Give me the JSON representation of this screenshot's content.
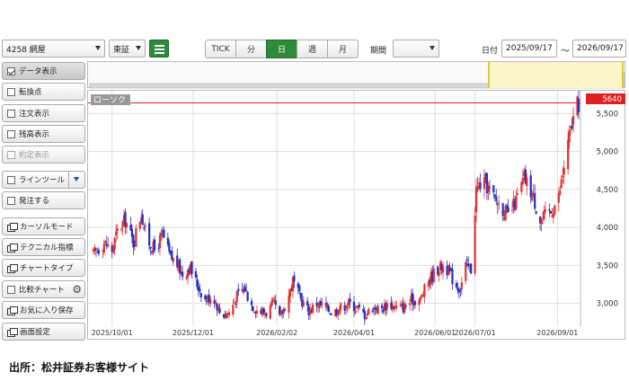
{
  "toolbar": {
    "symbol_select": "4258 網屋",
    "exchange_select": "東証",
    "period_tabs": [
      "TICK",
      "分",
      "日",
      "週",
      "月"
    ],
    "active_tab": "日",
    "period_label": "期間",
    "period_select": "",
    "date_label": "日付",
    "date_from": "2025/09/17",
    "date_separator": "〜",
    "date_to": "2026/09/17"
  },
  "sidebar": {
    "items": [
      {
        "label": "データ表示",
        "icon": "checkbox-checked",
        "state": "selected"
      },
      {
        "label": "転換点",
        "icon": "checkbox",
        "state": "normal"
      },
      {
        "label": "注文表示",
        "icon": "checkbox",
        "state": "normal"
      },
      {
        "label": "残高表示",
        "icon": "checkbox",
        "state": "normal"
      },
      {
        "label": "約定表示",
        "icon": "checkbox",
        "state": "disabled"
      },
      {
        "label": "ラインツール",
        "icon": "checkbox",
        "state": "normal"
      },
      {
        "label": "発注する",
        "icon": "checkbox",
        "state": "normal"
      },
      {
        "label": "カーソルモード",
        "icon": "window-icon",
        "state": "normal"
      },
      {
        "label": "テクニカル指標",
        "icon": "window-icon",
        "state": "normal"
      },
      {
        "label": "チャートタイプ",
        "icon": "window-icon",
        "state": "normal"
      },
      {
        "label": "比較チャート",
        "icon": "checkbox",
        "state": "normal"
      },
      {
        "label": "お気に入り保存",
        "icon": "window-icon",
        "state": "normal"
      },
      {
        "label": "画面設定",
        "icon": "window-icon",
        "state": "normal"
      }
    ]
  },
  "chart": {
    "overlay_label": "ローソク",
    "current_price_label": "5640",
    "colors": {
      "up": "#e03030",
      "down": "#2030c0",
      "current": "#e02020",
      "grid": "#dddddd",
      "nav_fill": "#d8d8d8"
    }
  },
  "chart_data": {
    "type": "candlestick",
    "current_price": 5640,
    "ylim": [
      2700,
      5800
    ],
    "y_ticks": [
      "3,000",
      "3,500",
      "4,000",
      "4,500",
      "5,000",
      "5,500"
    ],
    "y_tick_values": [
      3000,
      3500,
      4000,
      4500,
      5000,
      5500
    ],
    "x_ticks": [
      "2025/10/01",
      "2025/12/01",
      "2026/02/02",
      "2026/04/01",
      "2026/06/01",
      "2026/07/01",
      "2026/09/01"
    ],
    "x_tick_days": [
      14,
      75,
      138,
      196,
      257,
      287,
      349
    ],
    "date_range": [
      "2025/09/17",
      "2026/09/17"
    ],
    "close_path_days": [
      0,
      8,
      14,
      18,
      24,
      30,
      36,
      40,
      46,
      52,
      58,
      62,
      68,
      72,
      78,
      84,
      90,
      96,
      102,
      108,
      114,
      118,
      124,
      130,
      136,
      140,
      146,
      150,
      156,
      162,
      168,
      174,
      180,
      186,
      192,
      198,
      204,
      210,
      216,
      222,
      228,
      234,
      240,
      246,
      252,
      258,
      264,
      268,
      272,
      276,
      280,
      284,
      288,
      292,
      296,
      300,
      306,
      312,
      318,
      324,
      330,
      336,
      340,
      344,
      350,
      354,
      358,
      362,
      365
    ],
    "close_path_values": [
      3650,
      3800,
      3700,
      3950,
      4100,
      3800,
      4200,
      3850,
      3700,
      3900,
      3600,
      3550,
      3350,
      3500,
      3250,
      3050,
      3100,
      2850,
      2880,
      3100,
      3200,
      3000,
      2900,
      2880,
      3000,
      2800,
      3050,
      3300,
      3050,
      2900,
      3000,
      2950,
      2880,
      2950,
      3000,
      2950,
      2850,
      2950,
      2920,
      3000,
      2950,
      2950,
      3050,
      3050,
      3300,
      3450,
      3500,
      3400,
      3250,
      3200,
      3500,
      3450,
      4500,
      4600,
      4550,
      4400,
      4300,
      4150,
      4350,
      4650,
      4450,
      4100,
      4150,
      4200,
      4400,
      4800,
      5200,
      5500,
      5640
    ]
  }
}
